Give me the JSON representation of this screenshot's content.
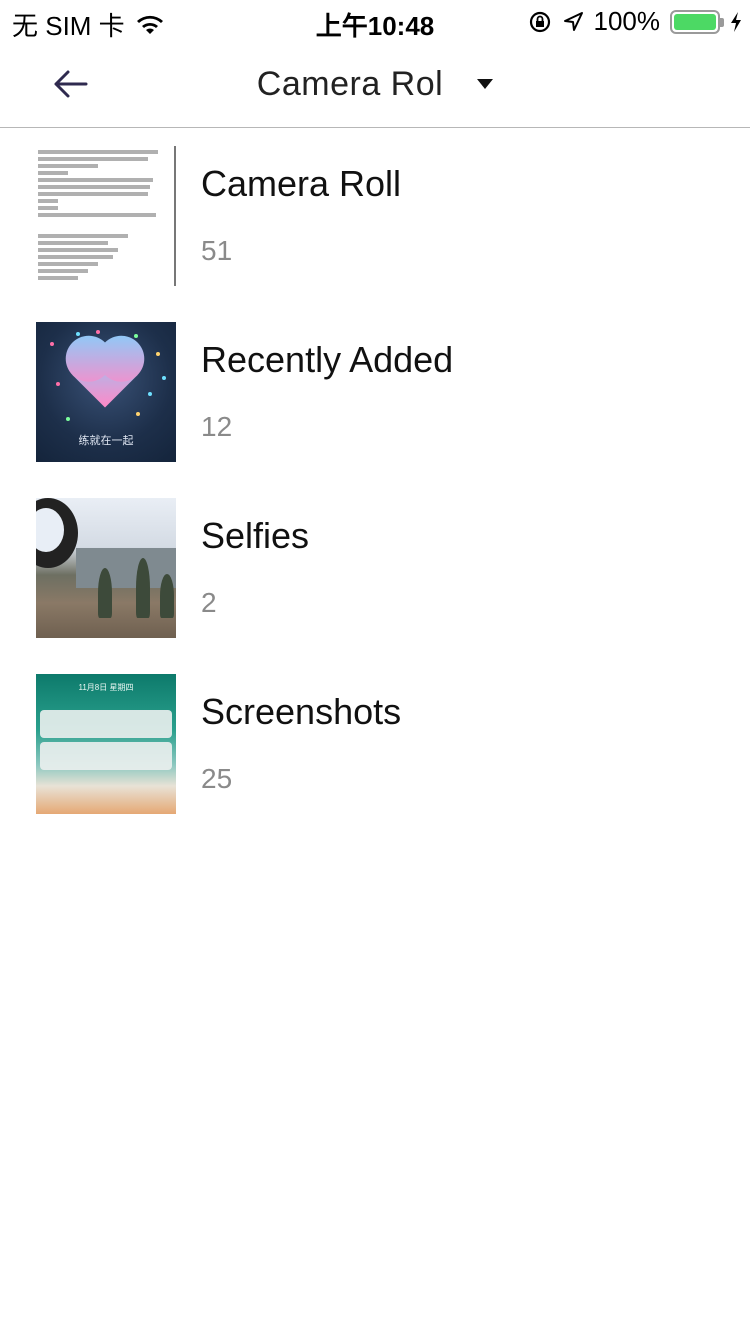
{
  "status_bar": {
    "carrier": "无 SIM 卡",
    "time": "上午10:48",
    "battery_percent": "100%",
    "battery_level": 1.0,
    "battery_color": "#4cd964",
    "icons": [
      "wifi-icon",
      "orientation-lock-icon",
      "location-arrow-icon",
      "battery-icon",
      "charging-bolt-icon"
    ]
  },
  "nav": {
    "title": "Camera Rol",
    "back_icon": "back-arrow-icon",
    "dropdown_icon": "caret-down-icon",
    "back_icon_color": "#2f2a4f"
  },
  "albums": [
    {
      "name": "Camera Roll",
      "count": "51"
    },
    {
      "name": "Recently Added",
      "count": "12"
    },
    {
      "name": "Selfies",
      "count": "2"
    },
    {
      "name": "Screenshots",
      "count": "25"
    }
  ],
  "thumbnail_texts": {
    "recent_caption": "练就在一起",
    "screenshots_header": "11月8日 星期四"
  }
}
